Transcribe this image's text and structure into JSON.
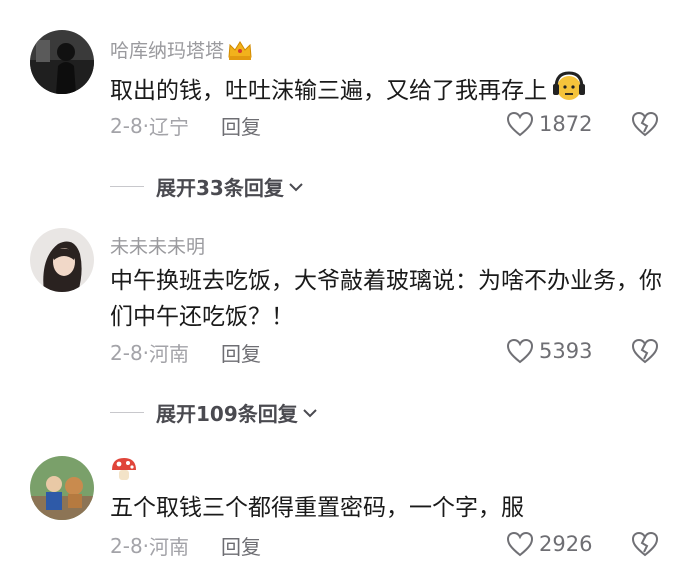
{
  "comments": [
    {
      "username": "哈库纳玛塔塔",
      "username_badge": "crown-icon",
      "text": "取出的钱，吐吐沫输三遍，又给了我再存上",
      "text_emoji": "headphones-face-emoji",
      "date": "2-8",
      "location": "辽宁",
      "reply_label": "回复",
      "likes": "1872",
      "expand_label": "展开33条回复"
    },
    {
      "username": "未未未未明",
      "text": "中午换班去吃饭，大爷敲着玻璃说：为啥不办业务，你们中午还吃饭？！",
      "date": "2-8",
      "location": "河南",
      "reply_label": "回复",
      "likes": "5393",
      "expand_label": "展开109条回复"
    },
    {
      "username_badge": "mushroom-icon",
      "text": "五个取钱三个都得重置密码，一个字，服",
      "date": "2-8",
      "location": "河南",
      "reply_label": "回复",
      "likes": "2926"
    }
  ],
  "colors": {
    "secondary_text": "#9a9a9e",
    "primary_text": "#1a1a1a",
    "crown": "#f2b21c",
    "mushroom": "#e0453a"
  }
}
